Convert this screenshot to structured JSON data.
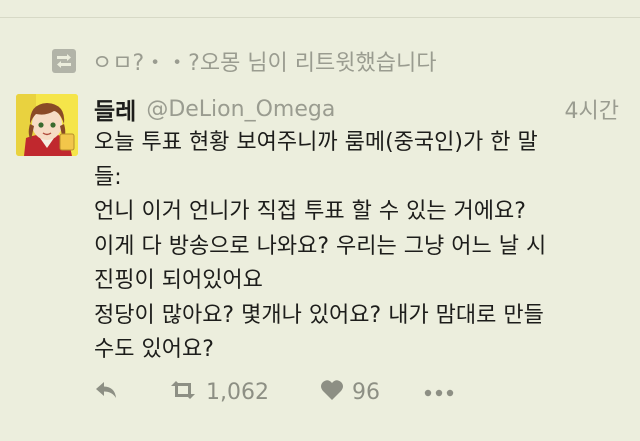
{
  "retweet_notice": {
    "text": "ㅇㅁ?・・?오몽 님이 리트윗했습니다"
  },
  "tweet": {
    "display_name": "들레",
    "handle": "@DeLion_Omega",
    "timestamp": "4시간",
    "lines": [
      "오늘 투표 현황 보여주니까 룸메(중국인)가 한 말",
      "들:",
      "언니 이거 언니가 직접 투표 할 수 있는 거에요?",
      "이게 다 방송으로 나와요? 우리는 그냥 어느 날 시",
      "진핑이 되어있어요",
      "정당이 많아요? 몇개나 있어요? 내가 맘대로 만들",
      "수도 있어요?"
    ]
  },
  "actions": {
    "reply_icon": "reply-icon",
    "retweet_icon": "retweet-icon",
    "retweet_count": "1,062",
    "like_icon": "heart-icon",
    "like_count": "96",
    "more_icon": "more-icon"
  },
  "colors": {
    "background": "#eceedd",
    "muted_text": "#9a9c90",
    "primary_text": "#1d1d1b"
  }
}
